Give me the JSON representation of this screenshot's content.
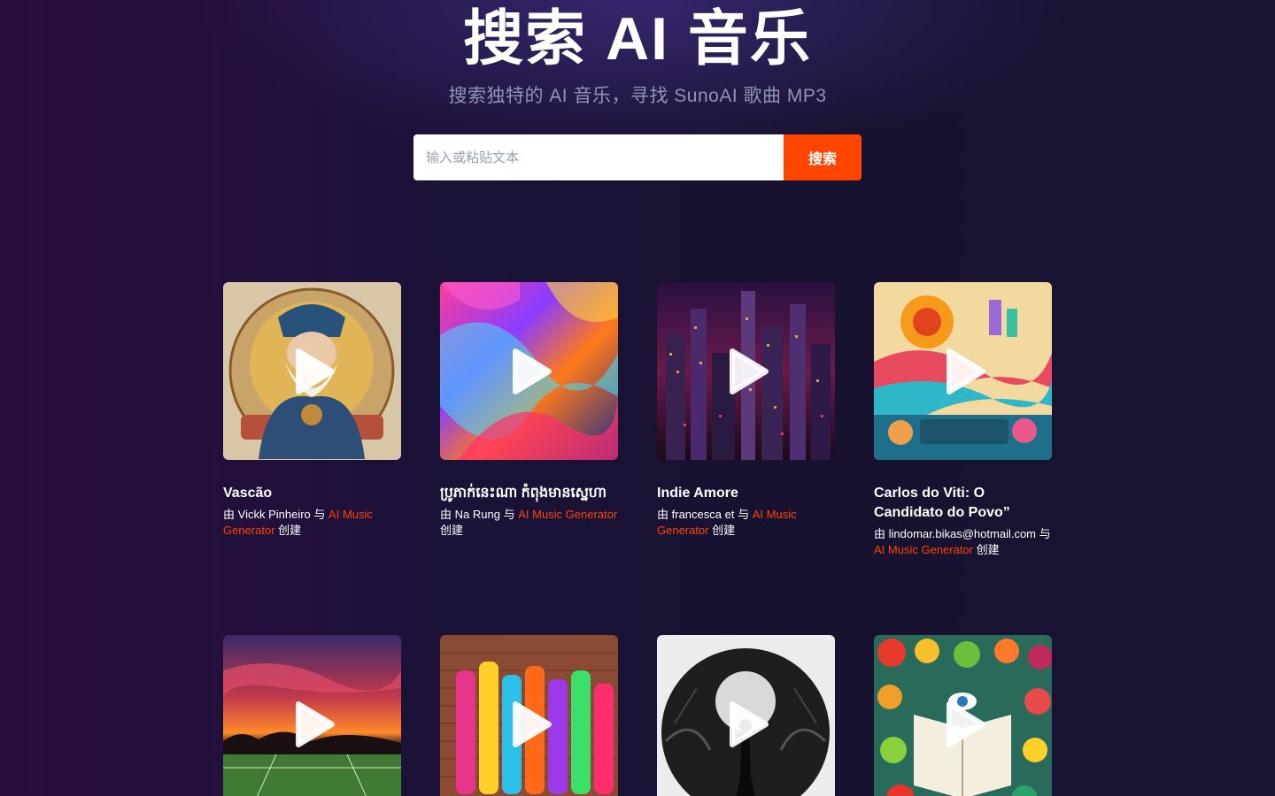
{
  "hero": {
    "title": "搜索 AI 音乐",
    "subtitle": "搜索独特的 AI 音乐，寻找 SunoAI 歌曲 MP3"
  },
  "search": {
    "placeholder": "输入或粘贴文本",
    "button_label": "搜索"
  },
  "meta_words": {
    "by": "由",
    "with": "与",
    "created": "创建"
  },
  "songs": [
    {
      "title": "Vascão",
      "creator": "Vickk Pinheiro",
      "generator": "AI Music Generator",
      "cover": "portrait-sage"
    },
    {
      "title": "ប្រូភាក់នេះណា កំពុងមានស្នេហា",
      "creator": "Na Rung",
      "generator": "AI Music Generator",
      "cover": "abstract-paint"
    },
    {
      "title": "Indie Amore",
      "creator": "francesca et",
      "generator": "AI Music Generator",
      "cover": "night-city"
    },
    {
      "title": "Carlos do Viti: O Candidato do Povo”",
      "creator": "lindomar.bikas@hotmail.com",
      "generator": "AI Music Generator",
      "cover": "folk-art-unity"
    },
    {
      "title": "",
      "creator": "",
      "generator": "",
      "cover": "sunset-field"
    },
    {
      "title": "",
      "creator": "",
      "generator": "",
      "cover": "graffiti-wall"
    },
    {
      "title": "",
      "creator": "",
      "generator": "",
      "cover": "moon-forest"
    },
    {
      "title": "",
      "creator": "",
      "generator": "",
      "cover": "fruit-book"
    }
  ],
  "colors": {
    "accent": "#ff4500",
    "subtitle": "#8c96b5"
  },
  "icons": {
    "play": "play-icon"
  }
}
